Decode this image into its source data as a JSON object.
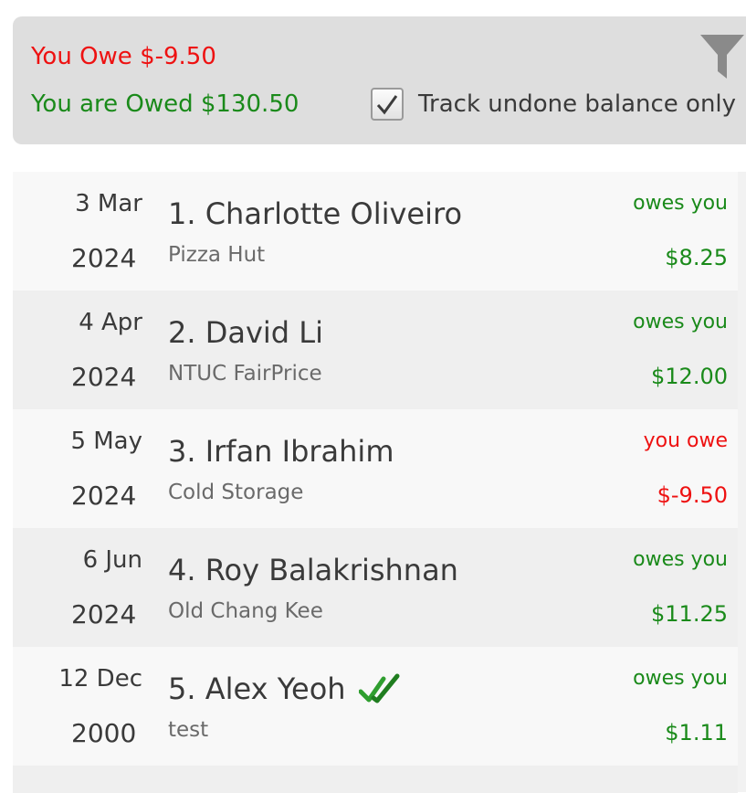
{
  "summary": {
    "you_owe": "You Owe $-9.50",
    "you_are_owed": "You are Owed $130.50",
    "track_label": "Track undone balance only",
    "track_checked": true,
    "filter_icon": "filter-icon"
  },
  "colors": {
    "owe": "#ee1111",
    "owed": "#1a8a1a"
  },
  "rows": [
    {
      "date": "3 Mar",
      "year": "2024",
      "name": "1. Charlotte Oliveiro",
      "place": "Pizza Hut",
      "status": "owes you",
      "amount": "$8.25",
      "type": "owed",
      "done": false
    },
    {
      "date": "4 Apr",
      "year": "2024",
      "name": "2. David Li",
      "place": "NTUC FairPrice",
      "status": "owes you",
      "amount": "$12.00",
      "type": "owed",
      "done": false
    },
    {
      "date": "5 May",
      "year": "2024",
      "name": "3. Irfan Ibrahim",
      "place": "Cold Storage",
      "status": "you owe",
      "amount": "$-9.50",
      "type": "owe",
      "done": false
    },
    {
      "date": "6 Jun",
      "year": "2024",
      "name": "4. Roy Balakrishnan",
      "place": "Old Chang Kee",
      "status": "owes you",
      "amount": "$11.25",
      "type": "owed",
      "done": false
    },
    {
      "date": "12 Dec",
      "year": "2000",
      "name": "5. Alex Yeoh",
      "place": "test",
      "status": "owes you",
      "amount": "$1.11",
      "type": "owed",
      "done": true
    }
  ]
}
